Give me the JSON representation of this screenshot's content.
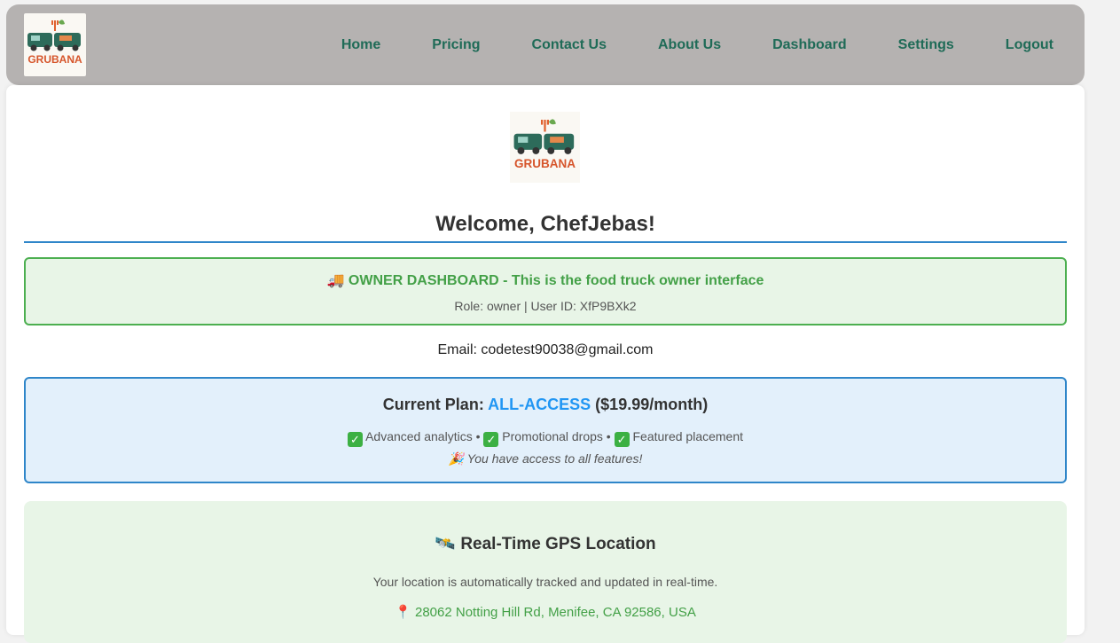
{
  "nav": {
    "logo_text": "GRUBANA",
    "links": [
      "Home",
      "Pricing",
      "Contact Us",
      "About Us",
      "Dashboard",
      "Settings",
      "Logout"
    ]
  },
  "main": {
    "logo_text": "GRUBANA",
    "welcome": "Welcome, ChefJebas!",
    "owner_banner": {
      "title": "🚚 OWNER DASHBOARD - This is the food truck owner interface",
      "subtitle": "Role: owner | User ID: XfP9BXk2"
    },
    "email": "Email: codetest90038@gmail.com",
    "plan": {
      "label": "Current Plan:",
      "name": "ALL-ACCESS",
      "price": "($19.99/month)",
      "features": [
        "Advanced analytics",
        "Promotional drops",
        "Featured placement"
      ],
      "note_icon": "🎉",
      "note": "You have access to all features!"
    },
    "gps": {
      "icon": "🛰️",
      "title": "Real-Time GPS Location",
      "description": "Your location is automatically tracked and updated in real-time.",
      "address": "📍 28062 Notting Hill Rd, Menifee, CA 92586, USA"
    }
  },
  "colors": {
    "navbar": "#b5b2b1",
    "nav_link": "#1f6b57",
    "owner_green": "#43a047",
    "plan_blue": "#2196f3",
    "rule_blue": "#2f86c9"
  }
}
